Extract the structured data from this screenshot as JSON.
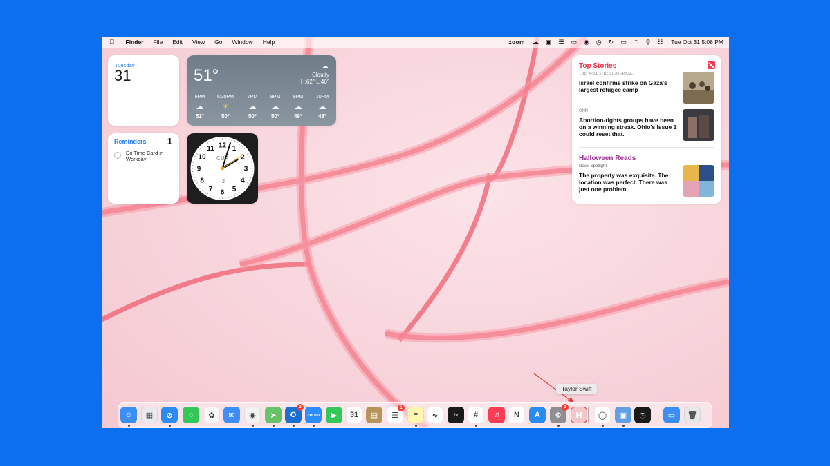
{
  "menubar": {
    "apple": "",
    "app_name": "Finder",
    "menus": [
      "File",
      "Edit",
      "View",
      "Go",
      "Window",
      "Help"
    ],
    "zoom_label": "zoom",
    "clock": "Tue Oct 31  5:08 PM",
    "status_icons": [
      "cloud-icon",
      "screen-icon",
      "script-icon",
      "display-icon",
      "malwarebytes-icon",
      "timer-icon",
      "sync-icon",
      "battery-icon",
      "wifi-icon",
      "search-icon",
      "control-center-icon"
    ]
  },
  "calendar_widget": {
    "day": "Tuesday",
    "date": "31"
  },
  "weather_widget": {
    "temp": "51°",
    "condition": "Cloudy",
    "high_low": "H:62° L:46°",
    "hours": [
      {
        "time": "6PM",
        "icon": "cloud-icon",
        "temp": "51°"
      },
      {
        "time": "6:30PM",
        "icon": "sunset-icon",
        "temp": "50°"
      },
      {
        "time": "7PM",
        "icon": "cloud-icon",
        "temp": "50°"
      },
      {
        "time": "8PM",
        "icon": "cloud-icon",
        "temp": "50°"
      },
      {
        "time": "9PM",
        "icon": "cloud-icon",
        "temp": "49°"
      },
      {
        "time": "10PM",
        "icon": "cloud-icon",
        "temp": "48°"
      }
    ]
  },
  "reminders_widget": {
    "title": "Reminders",
    "count": "1",
    "item": "Do Time Card in Workday"
  },
  "clock_widget": {
    "city": "CUP",
    "offset": "-3",
    "numbers": [
      "12",
      "1",
      "2",
      "3",
      "4",
      "5",
      "6",
      "7",
      "8",
      "9",
      "10",
      "11"
    ]
  },
  "news_widget": {
    "top_title": "Top Stories",
    "stories": [
      {
        "source": "THE WALL STREET JOURNAL.",
        "headline": "Israel confirms strike on Gaza's largest refugee camp"
      },
      {
        "source": "CNN",
        "headline": "Abortion-rights groups have been on a winning streak. Ohio's Issue 1 could reset that."
      }
    ],
    "halloween_title": "Halloween Reads",
    "halloween_story": {
      "source": "News Spotlight",
      "headline": "The property was exquisite. The location was perfect. There was just one problem."
    }
  },
  "tooltip": "Taylor Swift",
  "dock": {
    "apps": [
      {
        "name": "Finder",
        "color": "#3a8ef5",
        "glyph": "☺",
        "dot": true
      },
      {
        "name": "Launchpad",
        "color": "#e9e9ee",
        "glyph": "▦",
        "dot": false
      },
      {
        "name": "Safari",
        "color": "#2d8cf0",
        "glyph": "⊘",
        "dot": true
      },
      {
        "name": "Messages",
        "color": "#34c759",
        "glyph": "◌",
        "dot": false
      },
      {
        "name": "Photos",
        "color": "#f7f7f7",
        "glyph": "✿",
        "dot": false
      },
      {
        "name": "Mail",
        "color": "#3d8ef5",
        "glyph": "✉",
        "dot": false
      },
      {
        "name": "Chrome",
        "color": "#f2f2f2",
        "glyph": "◉",
        "dot": true
      },
      {
        "name": "Maps",
        "color": "#66c36a",
        "glyph": "➤",
        "dot": true
      },
      {
        "name": "Outlook",
        "color": "#1a6fd1",
        "glyph": "O",
        "dot": true,
        "badge": "3"
      },
      {
        "name": "Zoom",
        "color": "#2d8cff",
        "glyph": "zoom",
        "dot": true
      },
      {
        "name": "FaceTime",
        "color": "#34c759",
        "glyph": "▶",
        "dot": false
      },
      {
        "name": "Calendar",
        "color": "#ffffff",
        "glyph": "31",
        "dot": false
      },
      {
        "name": "Bear",
        "color": "#b8935a",
        "glyph": "▤",
        "dot": false
      },
      {
        "name": "Reminders",
        "color": "#ffffff",
        "glyph": "☰",
        "dot": false,
        "badge": "1"
      },
      {
        "name": "Notes",
        "color": "#fff6b0",
        "glyph": "≡",
        "dot": true
      },
      {
        "name": "Freeform",
        "color": "#ffffff",
        "glyph": "∿",
        "dot": false
      },
      {
        "name": "Apple TV",
        "color": "#1a1a1a",
        "glyph": "tv",
        "dot": false
      },
      {
        "name": "Slack",
        "color": "#ffffff",
        "glyph": "#",
        "dot": true
      },
      {
        "name": "Music",
        "color": "#fa3d55",
        "glyph": "♫",
        "dot": false
      },
      {
        "name": "News",
        "color": "#ffffff",
        "glyph": "N",
        "dot": false
      },
      {
        "name": "App Store",
        "color": "#2b8cf0",
        "glyph": "A",
        "dot": false
      },
      {
        "name": "System Settings",
        "color": "#8e8e93",
        "glyph": "⚙",
        "dot": true,
        "badge": "1"
      },
      {
        "name": "Taylor Swift",
        "color": "#f3c6cc",
        "glyph": "H",
        "dot": false
      },
      {
        "name": "Podcasts Alt",
        "color": "#ffffff",
        "glyph": "◯",
        "dot": true
      },
      {
        "name": "Preview",
        "color": "#5fa0e6",
        "glyph": "▣",
        "dot": true
      },
      {
        "name": "Clock",
        "color": "#1a1a1a",
        "glyph": "◷",
        "dot": false
      },
      {
        "name": "Downloads",
        "color": "#3a8ef5",
        "glyph": "▭",
        "dot": false
      },
      {
        "name": "Trash",
        "color": "#e7e7e7",
        "glyph": "🗑",
        "dot": false
      }
    ]
  }
}
